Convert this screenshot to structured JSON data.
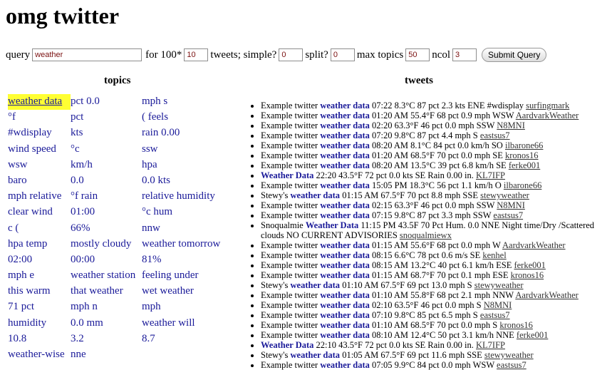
{
  "page": {
    "title": "omg twitter"
  },
  "form": {
    "query_label": "query",
    "query_value": "weather",
    "for_label": "for 100*",
    "count_value": "10",
    "tweets_simple_label": "tweets; simple?",
    "simple_value": "0",
    "split_label": "split?",
    "split_value": "0",
    "max_topics_label": "max topics",
    "max_topics_value": "50",
    "ncol_label": "ncol",
    "ncol_value": "3",
    "submit_label": "Submit Query"
  },
  "topics": {
    "heading": "topics",
    "items": [
      "weather data",
      "pct 0.0",
      "mph s",
      "°f",
      "pct",
      "( feels",
      "#wdisplay",
      "kts",
      "rain 0.00",
      "wind speed",
      "°c",
      "ssw",
      "wsw",
      "km/h",
      "hpa",
      "baro",
      "0.0",
      "0.0 kts",
      "mph relative",
      "°f rain",
      "relative humidity",
      "clear wind",
      "01:00",
      "°c hum",
      "c (",
      "66%",
      "nnw",
      "hpa temp",
      "mostly cloudy",
      "weather tomorrow",
      "02:00",
      "00:00",
      "81%",
      "mph e",
      "weather station",
      "feeling under",
      "this warm",
      "that weather",
      "wet weather",
      "71 pct",
      "mph n",
      "mph",
      "humidity",
      "0.0 mm",
      "weather will",
      "10.8",
      "3.2",
      "8.7",
      "weather-wise",
      "nne"
    ]
  },
  "tweets": {
    "heading": "tweets",
    "items": [
      {
        "pre": "Example twitter ",
        "kw": "weather data",
        "post": " 07:22 8.3°C 87 pct 2.3 kts ENE #wdisplay ",
        "user": "surfingmark"
      },
      {
        "pre": "Example twitter ",
        "kw": "weather data",
        "post": " 01:20 AM 55.4°F 68 pct 0.9 mph WSW ",
        "user": "AardvarkWeather"
      },
      {
        "pre": "Example twitter ",
        "kw": "weather data",
        "post": " 02:20 63.3°F 46 pct 0.0 mph SSW ",
        "user": "N8MNI"
      },
      {
        "pre": "Example twitter ",
        "kw": "weather data",
        "post": " 07:20 9.8°C 87 pct 4.4 mph S ",
        "user": "eastsus7"
      },
      {
        "pre": "Example twitter ",
        "kw": "weather data",
        "post": " 08:20 AM 8.1°C 84 pct 0.0 km/h SO ",
        "user": "ilbarone66"
      },
      {
        "pre": "Example twitter ",
        "kw": "weather data",
        "post": " 01:20 AM 68.5°F 70 pct 0.0 mph SE ",
        "user": "kronos16"
      },
      {
        "pre": "Example twitter ",
        "kw": "weather data",
        "post": " 08:20 AM 13.5°C 39 pct 6.8 km/h SE ",
        "user": "ferke001"
      },
      {
        "pre": "",
        "kw": "Weather Data",
        "post": " 22:20 43.5°F 72 pct 0.0 kts SE Rain 0.00 in. ",
        "user": "KL7IFP"
      },
      {
        "pre": "Example twitter ",
        "kw": "weather data",
        "post": " 15:05 PM 18.3°C 56 pct 1.1 km/h O ",
        "user": "ilbarone66"
      },
      {
        "pre": "Stewy's ",
        "kw": "weather data",
        "post": " 01:15 AM 67.5°F 70 pct 8.8 mph SSE ",
        "user": "stewyweather"
      },
      {
        "pre": "Example twitter ",
        "kw": "weather data",
        "post": " 02:15 63.3°F 46 pct 0.0 mph SSW ",
        "user": "N8MNI"
      },
      {
        "pre": "Example twitter ",
        "kw": "weather data",
        "post": " 07:15 9.8°C 87 pct 3.3 mph SSW ",
        "user": "eastsus7"
      },
      {
        "pre": "Snoqualmie ",
        "kw": "Weather Data",
        "post": " 11:15 PM 43.5F 70 Pct Hum. 0.0 NNE Night time/Dry /Scattered clouds NO CURRENT ADVISORIES ",
        "user": "snoqualmiewx"
      },
      {
        "pre": "Example twitter ",
        "kw": "weather data",
        "post": " 01:15 AM 55.6°F 68 pct 0.0 mph W ",
        "user": "AardvarkWeather"
      },
      {
        "pre": "Example twitter ",
        "kw": "weather data",
        "post": " 08:15 6.6°C 78 pct 0.6 m/s SE ",
        "user": "kenhel"
      },
      {
        "pre": "Example twitter ",
        "kw": "weather data",
        "post": " 08:15 AM 13.2°C 40 pct 6.1 km/h ESE ",
        "user": "ferke001"
      },
      {
        "pre": "Example twitter ",
        "kw": "weather data",
        "post": " 01:15 AM 68.7°F 70 pct 0.1 mph ESE ",
        "user": "kronos16"
      },
      {
        "pre": "Stewy's ",
        "kw": "weather data",
        "post": " 01:10 AM 67.5°F 69 pct 13.0 mph S ",
        "user": "stewyweather"
      },
      {
        "pre": "Example twitter ",
        "kw": "weather data",
        "post": " 01:10 AM 55.8°F 68 pct 2.1 mph NNW ",
        "user": "AardvarkWeather"
      },
      {
        "pre": "Example twitter ",
        "kw": "weather data",
        "post": " 02:10 63.5°F 46 pct 0.0 mph S ",
        "user": "N8MNI"
      },
      {
        "pre": "Example twitter ",
        "kw": "weather data",
        "post": " 07:10 9.8°C 85 pct 6.5 mph S ",
        "user": "eastsus7"
      },
      {
        "pre": "Example twitter ",
        "kw": "weather data",
        "post": " 01:10 AM 68.5°F 70 pct 0.0 mph S ",
        "user": "kronos16"
      },
      {
        "pre": "Example twitter ",
        "kw": "weather data",
        "post": " 08:10 AM 12.4°C 50 pct 3.1 km/h NNE ",
        "user": "ferke001"
      },
      {
        "pre": "",
        "kw": "Weather Data",
        "post": " 22:10 43.5°F 72 pct 0.0 kts SE Rain 0.00 in. ",
        "user": "KL7IFP"
      },
      {
        "pre": "Stewy's ",
        "kw": "weather data",
        "post": " 01:05 AM 67.5°F 69 pct 11.6 mph SSE ",
        "user": "stewyweather"
      },
      {
        "pre": "Example twitter ",
        "kw": "weather data",
        "post": " 07:05 9.9°C 84 pct 0.0 mph WSW ",
        "user": "eastsus7"
      }
    ]
  }
}
